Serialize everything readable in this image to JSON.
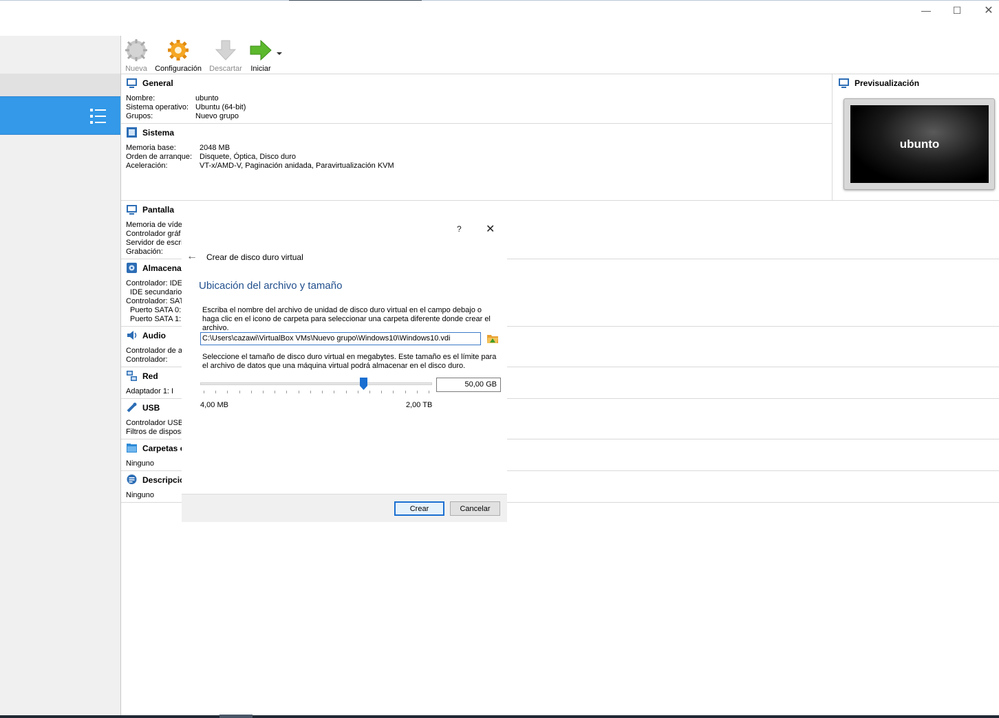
{
  "window": {
    "minimize": "—",
    "maximize": "☐",
    "close": "✕"
  },
  "toolbar": {
    "new_label": "Nueva",
    "settings_label": "Configuración",
    "discard_label": "Descartar",
    "start_label": "Iniciar"
  },
  "details": {
    "general": {
      "title": "General",
      "rows": [
        {
          "label": "Nombre:",
          "value": "ubunto"
        },
        {
          "label": "Sistema operativo:",
          "value": "Ubuntu (64-bit)"
        },
        {
          "label": "Grupos:",
          "value": "Nuevo grupo"
        }
      ]
    },
    "system": {
      "title": "Sistema",
      "rows": [
        {
          "label": "Memoria base:",
          "value": "2048 MB"
        },
        {
          "label": "Orden de arranque:",
          "value": "Disquete, Óptica, Disco duro"
        },
        {
          "label": "Aceleración:",
          "value": "VT-x/AMD-V, Paginación anidada, Paravirtualización KVM"
        }
      ]
    },
    "display": {
      "title": "Pantalla",
      "rows": [
        "Memoria de víde",
        "Controlador gráf",
        "Servidor de escri",
        "Grabación:"
      ]
    },
    "storage": {
      "title": "Almacena",
      "rows": [
        "Controlador: IDE",
        "IDE secundario",
        "Controlador: SAT",
        "Puerto SATA 0:",
        "Puerto SATA 1:"
      ]
    },
    "audio": {
      "title": "Audio",
      "rows": [
        "Controlador de a",
        "Controlador:"
      ]
    },
    "network": {
      "title": "Red",
      "rows": [
        "Adaptador 1:   I"
      ]
    },
    "usb": {
      "title": "USB",
      "rows": [
        "Controlador USB",
        "Filtros de disposi"
      ]
    },
    "shared": {
      "title": "Carpetas c",
      "rows": [
        "Ninguno"
      ]
    },
    "description": {
      "title": "Descripció",
      "rows": [
        "Ninguno"
      ]
    }
  },
  "preview": {
    "title": "Previsualización",
    "vm_name": "ubunto"
  },
  "dialog": {
    "help": "?",
    "close": "✕",
    "back": "←",
    "title": "Crear de disco duro virtual",
    "heading": "Ubicación del archivo y tamaño",
    "instructions_file": "Escriba el nombre del archivo de unidad de disco duro virtual en el campo debajo o haga clic en el icono de carpeta para seleccionar una carpeta diferente donde crear el archivo.",
    "file_path": "C:\\Users\\cazawi\\VirtualBox VMs\\Nuevo grupo\\Windows10\\Windows10.vdi",
    "instructions_size": "Seleccione el tamaño de disco duro virtual en megabytes. Este tamaño es el límite para el archivo de datos que una máquina virtual podrá almacenar en el disco duro.",
    "size_value": "50,00 GB",
    "slider_min": "4,00 MB",
    "slider_max": "2,00 TB",
    "slider_position": 0.705,
    "create_label": "Crear",
    "cancel_label": "Cancelar"
  },
  "colors": {
    "selection": "#3399e8",
    "heading_blue": "#1f4e8c",
    "accent_green": "#5cb82c",
    "accent_orange": "#f0a020"
  }
}
